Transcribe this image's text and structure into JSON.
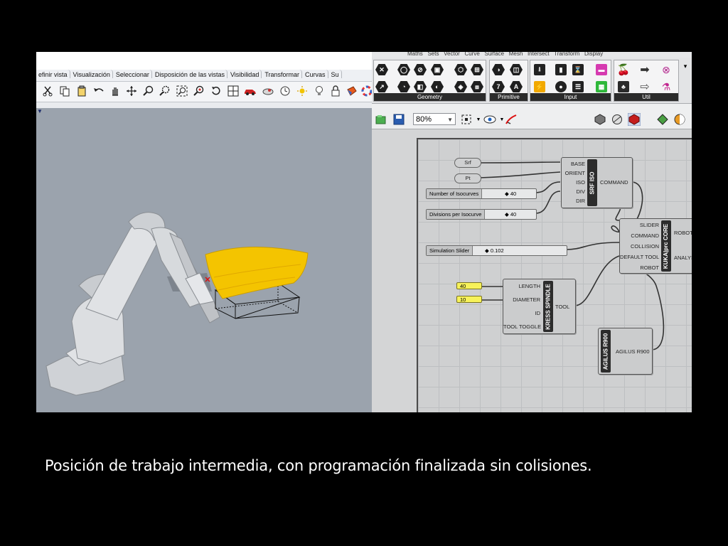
{
  "rhino": {
    "menu_tabs": [
      "efinir vista",
      "Visualización",
      "Seleccionar",
      "Disposición de las vistas",
      "Visibilidad",
      "Transformar",
      "Curvas",
      "Su"
    ],
    "toolbar_icons": [
      "cut-icon",
      "copy-icon",
      "paste-icon",
      "undo-icon",
      "pan-icon",
      "rotate-view-icon",
      "zoom-icon",
      "zoom-window-icon",
      "zoom-extents-icon",
      "zoom-selected-icon",
      "rotate-icon",
      "viewport-layout-icon",
      "car-icon",
      "display-mode-icon",
      "clock-icon",
      "light-icon",
      "lock-icon",
      "material-icon",
      "color-wheel-icon"
    ]
  },
  "grasshopper": {
    "menu_text": "Maths   Sets   Vector   Curve   Surface   Mesh   Intersect   Transform   Display",
    "ribbon_groups": {
      "geometry": "Geometry",
      "primitive": "Primitive",
      "input": "Input",
      "util": "Util"
    },
    "zoom": "80%",
    "components": {
      "srf_iso": {
        "title": "SRF ISO",
        "inputs": [
          "BASE",
          "ORIENT",
          "ISO",
          "DIV",
          "DIR"
        ],
        "output": "COMMAND"
      },
      "kuka": {
        "title": "KUKA|prc CORE",
        "inputs": [
          "SLIDER",
          "COMMAND",
          "COLLISION",
          "DEFAULT TOOL",
          "ROBOT"
        ],
        "outputs": [
          "ROBOT",
          "ANALYS"
        ]
      },
      "kress": {
        "title": "KRESS SPINDLE",
        "inputs": [
          "LENGTH",
          "DIAMETER",
          "ID",
          "TOOL TOGGLE"
        ],
        "output": "TOOL"
      },
      "agilus": {
        "title": "AGILUS R900",
        "output": "AGILUS R900"
      }
    },
    "params": {
      "srf": "Srf",
      "pt": "Pt"
    },
    "sliders": {
      "isocurves": {
        "label": "Number of Isocurves",
        "value": "40"
      },
      "divisions": {
        "label": "Divisions per Isocurve",
        "value": "40"
      },
      "simulation": {
        "label": "Simulation Slider",
        "value": "0.102"
      }
    },
    "panels": {
      "length": "40",
      "diameter": "10"
    }
  },
  "caption": "Posición de trabajo intermedia, con programación finalizada sin colisiones."
}
